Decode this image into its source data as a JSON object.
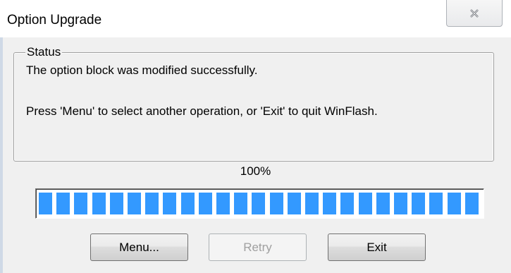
{
  "window": {
    "title": "Option Upgrade",
    "close_icon": "close-icon"
  },
  "status": {
    "group_label": "Status",
    "message": "The option block was modified successfully.",
    "instruction": "Press 'Menu' to select another operation, or 'Exit' to quit WinFlash."
  },
  "progress": {
    "percent_text": "100%",
    "value": 1.0,
    "segment_count": 25,
    "color": "#3399ff"
  },
  "buttons": {
    "menu": "Menu...",
    "retry": "Retry",
    "exit": "Exit"
  }
}
